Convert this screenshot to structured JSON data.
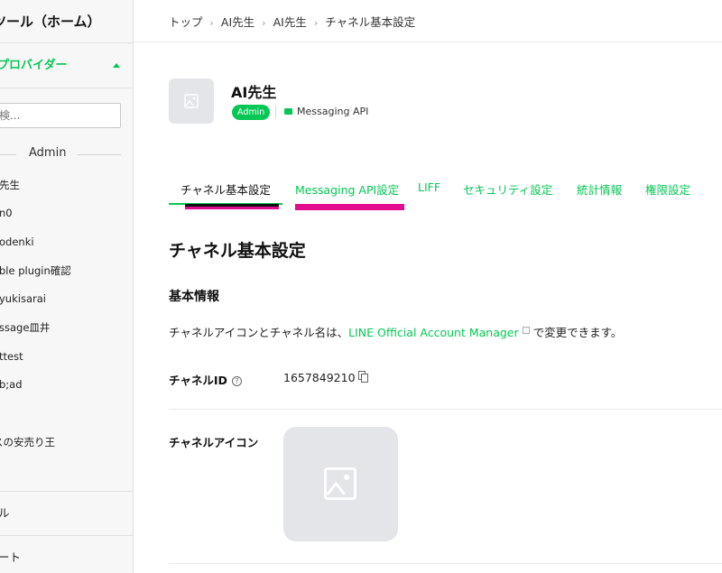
{
  "sidebar": {
    "home_label": "ツール（ホーム）",
    "provider_label": "プロバイダー",
    "search_placeholder": "検...",
    "admin_group": "Admin",
    "channels": [
      "先生",
      "n0",
      "odenki",
      "ble plugin確認",
      "yukisarai",
      "ssage皿井",
      "ttest",
      "b;ad",
      "スの安売り王"
    ],
    "bottom_items": [
      "ル",
      "ート"
    ]
  },
  "breadcrumb": [
    "トップ",
    "AI先生",
    "AI先生",
    "チャネル基本設定"
  ],
  "channel": {
    "name": "AI先生",
    "badge": "Admin",
    "api_type": "Messaging API"
  },
  "tabs": [
    "チャネル基本設定",
    "Messaging API設定",
    "LIFF",
    "セキュリティ設定",
    "統計情報",
    "権限設定"
  ],
  "page": {
    "title": "チャネル基本設定",
    "section_title": "基本情報",
    "desc_prefix": "チャネルアイコンとチャネル名は、",
    "desc_link": "LINE Official Account Manager",
    "desc_suffix": "で変更できます。",
    "channel_id_label": "チャネルID",
    "channel_id_value": "1657849210",
    "channel_icon_label": "チャネルアイコン"
  },
  "colors": {
    "accent": "#06c755",
    "highlight": "#e40b8f"
  }
}
